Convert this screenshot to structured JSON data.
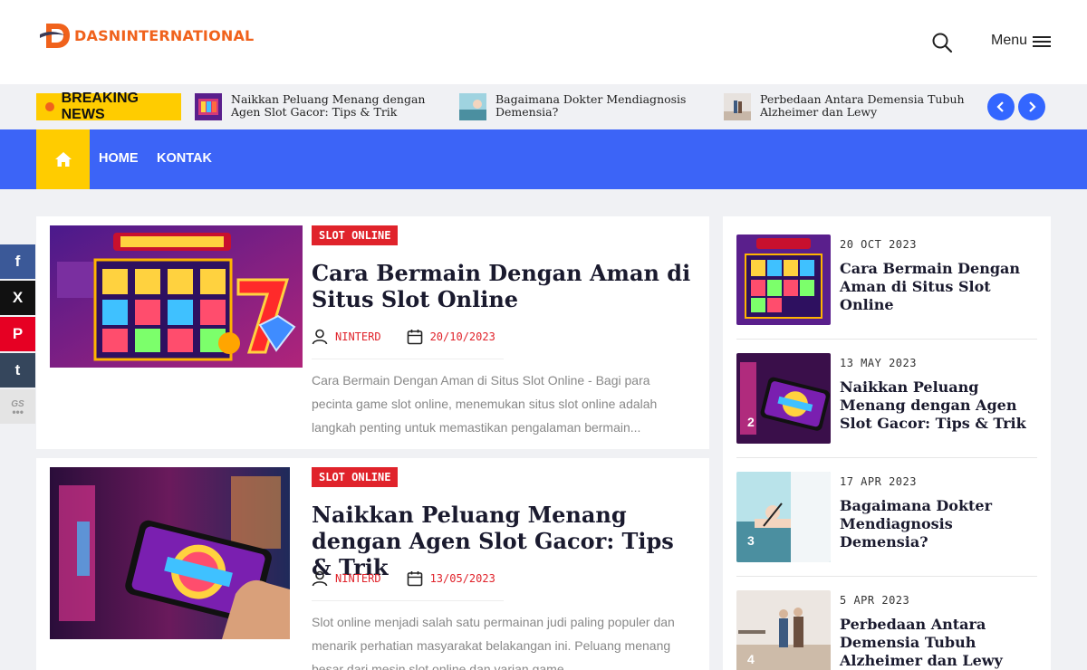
{
  "header": {
    "logo_text": "DASNINTERNATIONAL",
    "menu_label": "Menu"
  },
  "breaking": {
    "label": "BREAKING NEWS",
    "items": [
      {
        "title": "Naikkan Peluang Menang dengan Agen Slot Gacor: Tips & Trik"
      },
      {
        "title": "Bagaimana Dokter Mendiagnosis Demensia?"
      },
      {
        "title": "Perbedaan Antara Demensia Tubuh Alzheimer dan Lewy"
      }
    ]
  },
  "nav": {
    "items": [
      "HOME",
      "KONTAK"
    ]
  },
  "posts": [
    {
      "category": "SLOT ONLINE",
      "title": "Cara Bermain Dengan Aman di Situs Slot Online",
      "author": "NINTERD",
      "date": "20/10/2023",
      "excerpt": "Cara Bermain Dengan Aman di Situs Slot Online - Bagi para pecinta game slot online, menemukan situs slot online adalah langkah penting untuk memastikan pengalaman bermain..."
    },
    {
      "category": "SLOT ONLINE",
      "title": "Naikkan Peluang Menang dengan Agen Slot Gacor: Tips & Trik",
      "author": "NINTERD",
      "date": "13/05/2023",
      "excerpt": "Slot online menjadi salah satu permainan judi paling populer dan menarik perhatian masyarakat belakangan ini. Peluang menang besar dari mesin slot online dan varian game"
    }
  ],
  "sidebar": {
    "items": [
      {
        "date": "20 OCT 2023",
        "title": "Cara Bermain Dengan Aman di Situs Slot Online",
        "num": ""
      },
      {
        "date": "13 MAY 2023",
        "title": "Naikkan Peluang Menang dengan Agen Slot Gacor: Tips & Trik",
        "num": "2"
      },
      {
        "date": "17 APR 2023",
        "title": "Bagaimana Dokter Mendiagnosis Demensia?",
        "num": "3"
      },
      {
        "date": "5 APR 2023",
        "title": "Perbedaan Antara Demensia Tubuh Alzheimer dan Lewy",
        "num": "4"
      }
    ]
  },
  "social": {
    "facebook": "f",
    "x": "X",
    "pinterest": "P",
    "tumblr": "t",
    "gs": "GS"
  },
  "colors": {
    "accent": "#3c64f7",
    "brand_orange": "#f0621c",
    "badge_red": "#e0232b",
    "yellow": "#ffcc00"
  }
}
